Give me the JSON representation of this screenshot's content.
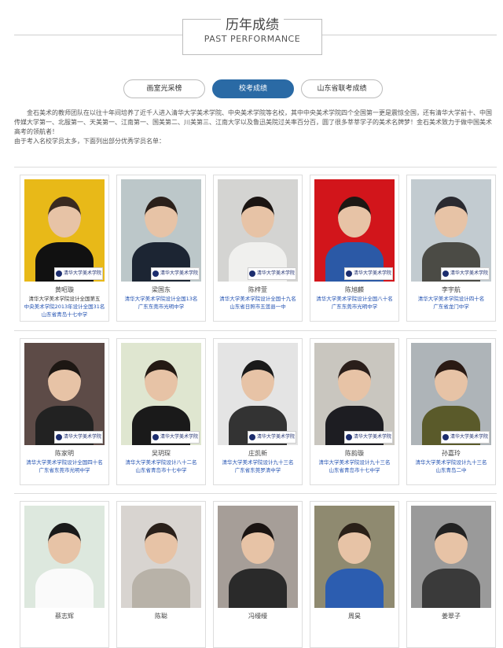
{
  "header": {
    "title_cn": "历年成绩",
    "title_en": "PAST PERFORMANCE"
  },
  "tabs": [
    {
      "label": "画室光采榜"
    },
    {
      "label": "校考成绩"
    },
    {
      "label": "山东省联考成绩"
    }
  ],
  "intro": {
    "p1": "金石美术的教师团队在以往十年间培养了近千人进入清华大学美术学院、中央美术学院等名校，其中中央美术学院四个全国第一更是震惊全国，还有清华大学前十、中国传媒大学第一、北服第一、天美第一、江南第一、国美第二、川美第三、江南大学以及鲁迅美院过关率百分百，圆了很多莘莘学子的美术名牌梦！金石美术致力于做中国美术高考的领航者！",
    "p2": "由于考入名校学员太多，下面列出部分优秀学员名单："
  },
  "logo_text": "清华大学美术学院",
  "students": [
    {
      "name": "黄昭璇",
      "lines": [
        "清华大学美术学院设计全国第五",
        "中央美术学院2013年设计全国31名",
        "山东省青岛十七中学"
      ]
    },
    {
      "name": "梁国东",
      "lines": [
        "清华大学美术学院设计全国13名",
        "广东东莞市光明中学"
      ]
    },
    {
      "name": "陈梓萱",
      "lines": [
        "清华大学美术学院设计全国十九名",
        "山东省日照市五莲县一中"
      ]
    },
    {
      "name": "陈旭麟",
      "lines": [
        "清华大学美术学院设计全国八十名",
        "广东东莞市光明中学"
      ]
    },
    {
      "name": "李宇航",
      "lines": [
        "清华大学美术学院设计四十名",
        "广东省龙门中学"
      ]
    },
    {
      "name": "陈家明",
      "lines": [
        "清华大学美术学院设计全国四十名",
        "广东省东莞市光明中学"
      ]
    },
    {
      "name": "吴玥琛",
      "lines": [
        "清华大学美术学院设计八十二名",
        "山东省青岛市十七中学"
      ]
    },
    {
      "name": "庄凯新",
      "lines": [
        "清华大学美术学院设计九十三名",
        "广东省东莞罗清中学"
      ]
    },
    {
      "name": "陈韵璇",
      "lines": [
        "清华大学美术学院设计九十三名",
        "山东省青岛市十七中学"
      ]
    },
    {
      "name": "孙嘉玲",
      "lines": [
        "清华大学美术学院设计九十三名",
        "山东青岛二中"
      ]
    },
    {
      "name": "蔡志辉",
      "lines": []
    },
    {
      "name": "陈聪",
      "lines": []
    },
    {
      "name": "冯缦缦",
      "lines": []
    },
    {
      "name": "周昊",
      "lines": []
    },
    {
      "name": "姜翠子",
      "lines": []
    }
  ]
}
